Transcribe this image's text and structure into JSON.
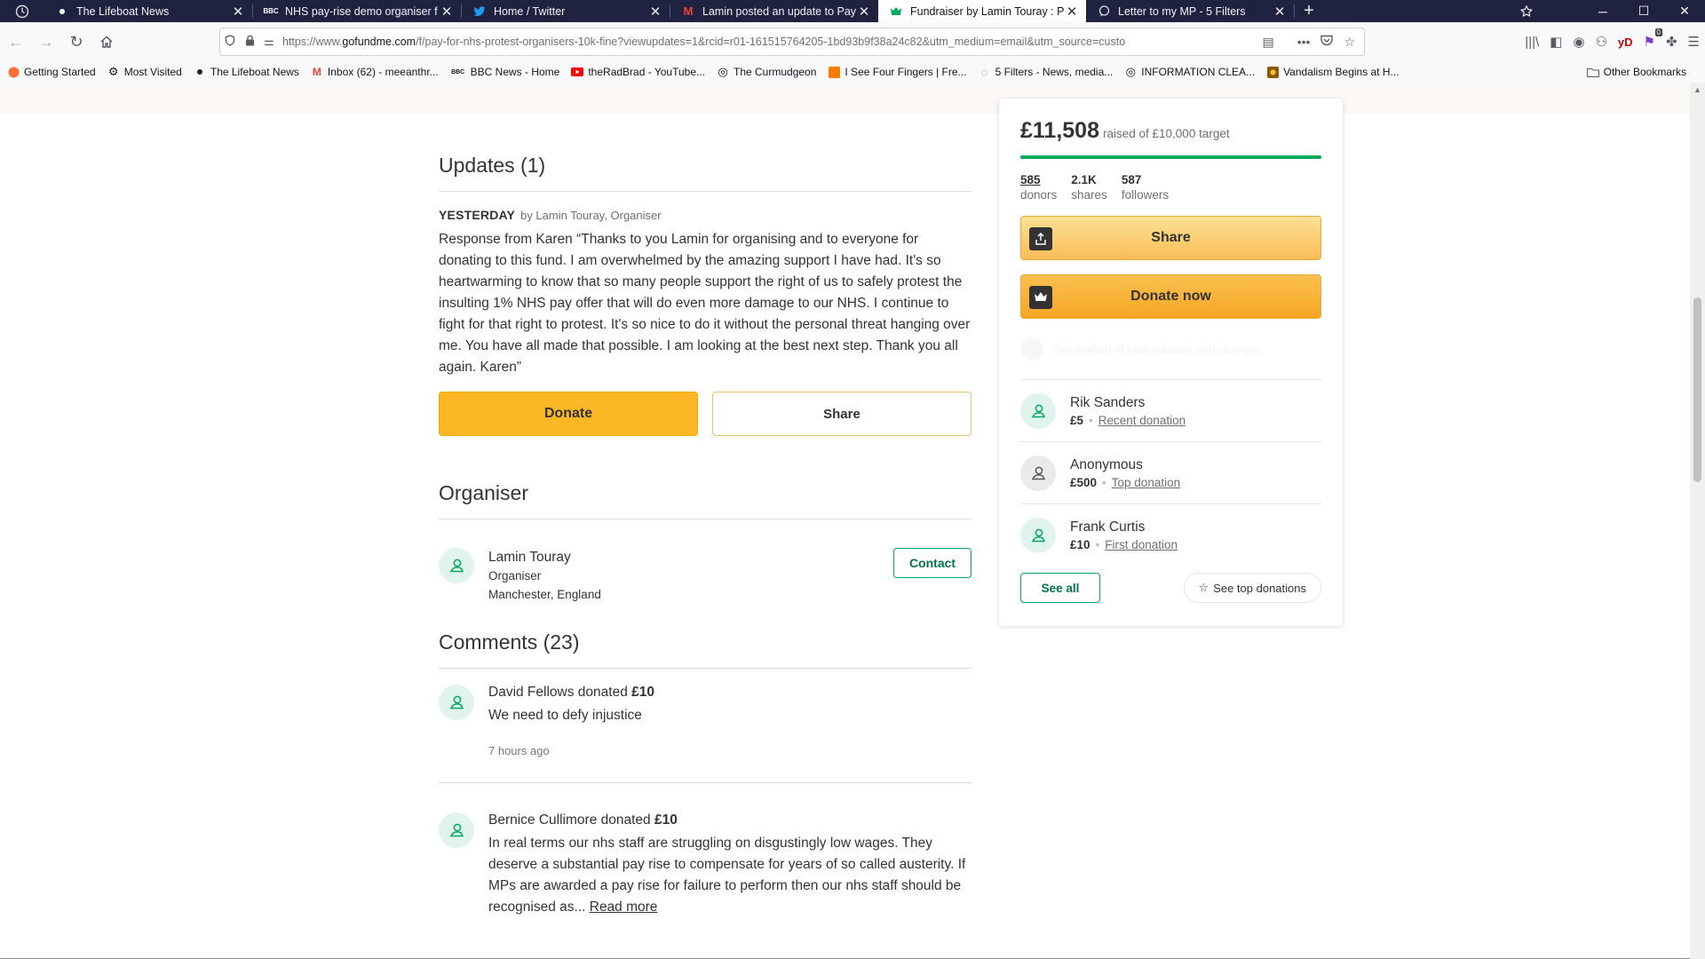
{
  "browser": {
    "tabs": [
      {
        "title": "The Lifeboat News",
        "favicon": "dot-icon",
        "active": false
      },
      {
        "title": "NHS pay-rise demo organiser f",
        "favicon": "bbc-icon",
        "active": false
      },
      {
        "title": "Home / Twitter",
        "favicon": "twitter-bird-icon",
        "active": false
      },
      {
        "title": "Lamin posted an update to Pay",
        "favicon": "gmail-icon",
        "active": false
      },
      {
        "title": "Fundraiser by Lamin Touray : P",
        "favicon": "gofundme-icon",
        "active": true
      },
      {
        "title": "Letter to my MP - 5 Filters",
        "favicon": "speech-bubble-icon",
        "active": false
      }
    ],
    "url_prefix": "https://www.",
    "url_domain": "gofundme.com",
    "url_rest": "/f/pay-for-nhs-protest-organisers-10k-fine?viewupdates=1&rcid=r01-161515764205-1bd93b9f38a24c82&utm_medium=email&utm_source=custo",
    "bookmarks": [
      {
        "label": "Getting Started",
        "icon": "firefox-icon"
      },
      {
        "label": "Most Visited",
        "icon": "gear-icon"
      },
      {
        "label": "The Lifeboat News",
        "icon": "dot-icon"
      },
      {
        "label": "Inbox (62) - meeanthr...",
        "icon": "gmail-icon"
      },
      {
        "label": "BBC News - Home",
        "icon": "bbc-icon"
      },
      {
        "label": "theRadBrad - YouTube...",
        "icon": "youtube-icon"
      },
      {
        "label": "The Curmudgeon",
        "icon": "globe-icon"
      },
      {
        "label": "I See Four Fingers | Fre...",
        "icon": "blogger-icon"
      },
      {
        "label": "5 Filters - News, media...",
        "icon": "speech-bubble-icon"
      },
      {
        "label": "INFORMATION CLEA...",
        "icon": "globe-icon"
      },
      {
        "label": "Vandalism Begins at H...",
        "icon": "image-icon"
      }
    ],
    "other_bookmarks": "Other Bookmarks",
    "badge_count": "0"
  },
  "updates": {
    "heading": "Updates (1)",
    "when": "YESTERDAY",
    "by": "by Lamin Touray, Organiser",
    "body": "Response from Karen “Thanks to you Lamin for organising and to everyone for donating to this fund. I am overwhelmed by the amazing support I have had. It's so heartwarming to know that so many people support the right of us to safely protest the insulting 1% NHS pay offer that will do even more damage to our NHS. I continue to fight for that right to protest. It's so nice to do it without the personal threat hanging over me. You have all made that possible. I am looking at the best next step. Thank you all again. Karen”",
    "donate_label": "Donate",
    "share_label": "Share"
  },
  "organiser": {
    "heading": "Organiser",
    "name": "Lamin Touray",
    "role": "Organiser",
    "location": "Manchester, England",
    "contact_label": "Contact"
  },
  "comments": {
    "heading": "Comments (23)",
    "donated_word": "donated",
    "items": [
      {
        "name": "David Fellows",
        "amount": "£10",
        "text": "We need to defy injustice",
        "time": "7 hours ago"
      },
      {
        "name": "Bernice Cullimore",
        "amount": "£10",
        "text": "In real terms our nhs staff are struggling on disgustingly low wages. They deserve a substantial pay rise to compensate for years of so called austerity. If MPs are awarded a pay rise for failure to perform then our nhs staff should be recognised as...",
        "read_more": "Read more"
      }
    ]
  },
  "sidebar": {
    "raised": "£11,508",
    "raised_text": "raised of £10,000 target",
    "progress_fraction": 1.0,
    "stats": [
      {
        "value": "585",
        "label": "donors"
      },
      {
        "value": "2.1K",
        "label": "shares"
      },
      {
        "value": "587",
        "label": "followers"
      }
    ],
    "share_label": "Share",
    "donate_label": "Donate now",
    "faded_text": "Get notified of new updates and changes",
    "donations": [
      {
        "name": "Rik Sanders",
        "amount": "£5",
        "tag": "Recent donation",
        "anonymous": false
      },
      {
        "name": "Anonymous",
        "amount": "£500",
        "tag": "Top donation",
        "anonymous": true
      },
      {
        "name": "Frank Curtis",
        "amount": "£10",
        "tag": "First donation",
        "anonymous": false
      }
    ],
    "see_all_label": "See all",
    "see_top_label": "See top donations"
  },
  "colors": {
    "accent_green": "#02a95c",
    "donate_yellow": "#fbb726",
    "tab_bar": "#202340"
  }
}
